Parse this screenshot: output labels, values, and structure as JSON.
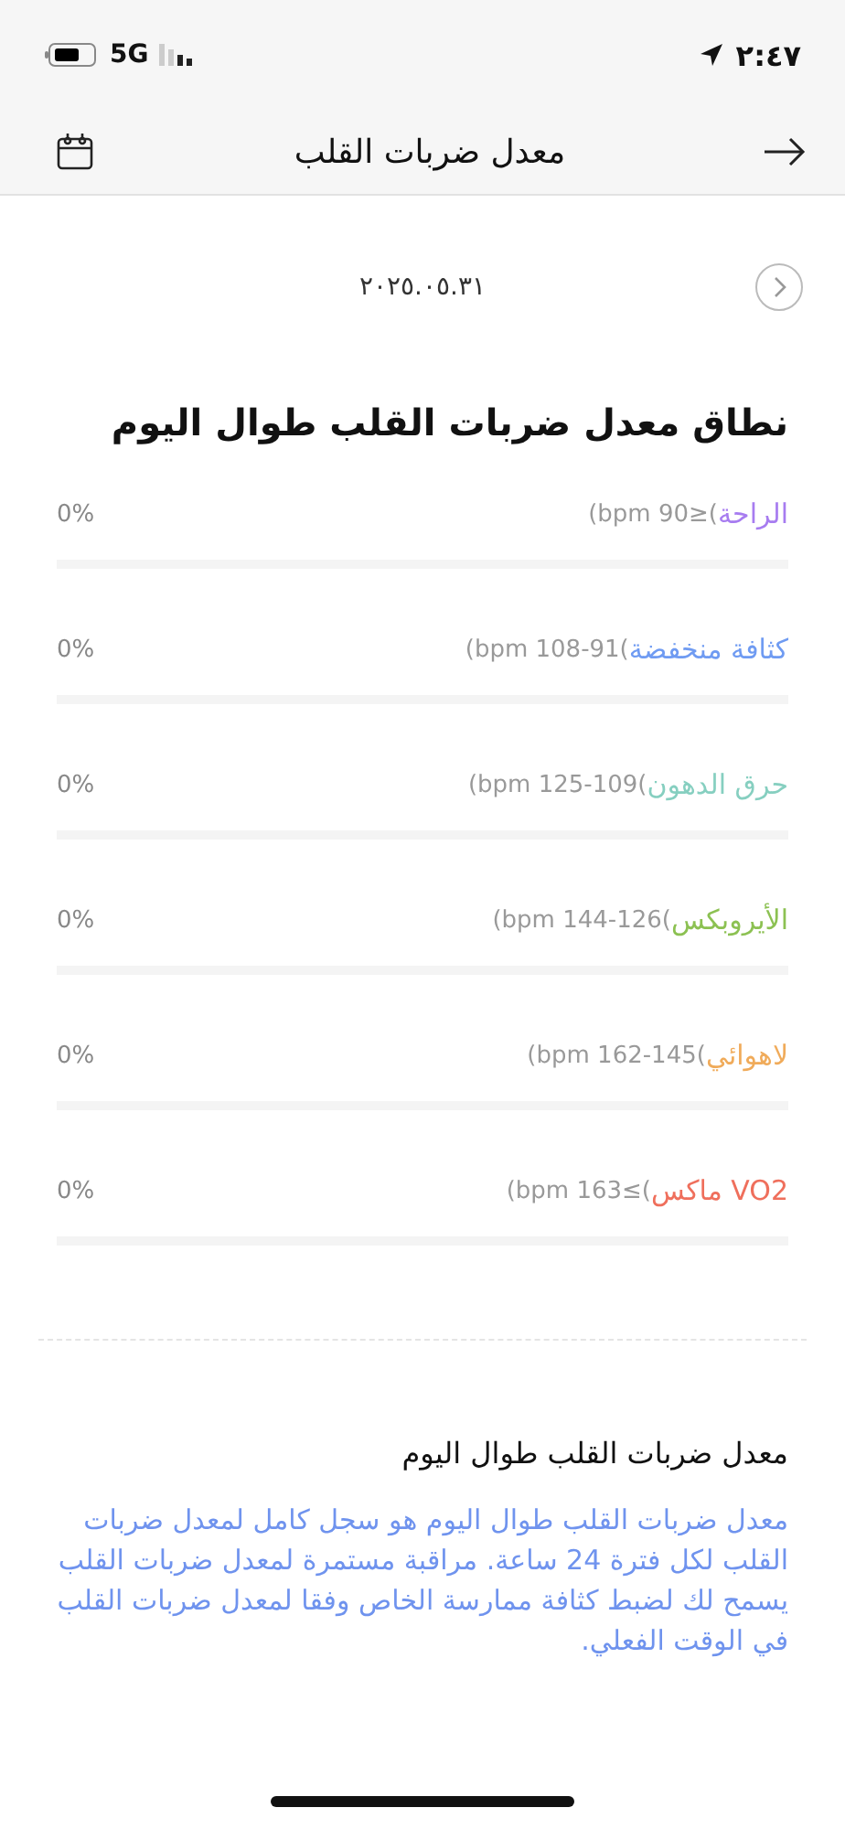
{
  "status_bar": {
    "network": "5G",
    "time": "٢:٤٧"
  },
  "header": {
    "title": "معدل ضربات القلب"
  },
  "date": "٢٠٢٥.٠٥.٣١",
  "zones_title": "نطاق معدل ضربات القلب طوال اليوم",
  "zones": [
    {
      "name": "الراحة",
      "range": "(bpm 90≥(",
      "percent": "0%",
      "color": "#a77cf0"
    },
    {
      "name": "كثافة منخفضة",
      "range": "(bpm 108-91(",
      "percent": "0%",
      "color": "#6f9bf2"
    },
    {
      "name": "حرق الدهون",
      "range": "(bpm 125-109(",
      "percent": "0%",
      "color": "#86cfc0"
    },
    {
      "name": "الأيروبكس",
      "range": "(bpm 144-126(",
      "percent": "0%",
      "color": "#8cc152"
    },
    {
      "name": "لاهوائي",
      "range": "(bpm 162-145(",
      "percent": "0%",
      "color": "#f0ab5a"
    },
    {
      "name": "VO2 ماكس",
      "range": "(bpm 163≤(",
      "percent": "0%",
      "color": "#ef6f5c"
    }
  ],
  "info": {
    "title": "معدل ضربات القلب طوال اليوم",
    "body": "معدل ضربات القلب طوال اليوم هو سجل كامل لمعدل ضربات القلب لكل فترة 24 ساعة. مراقبة مستمرة لمعدل ضربات القلب يسمح لك لضبط كثافة ممارسة الخاص وفقا لمعدل ضربات القلب في الوقت الفعلي."
  }
}
